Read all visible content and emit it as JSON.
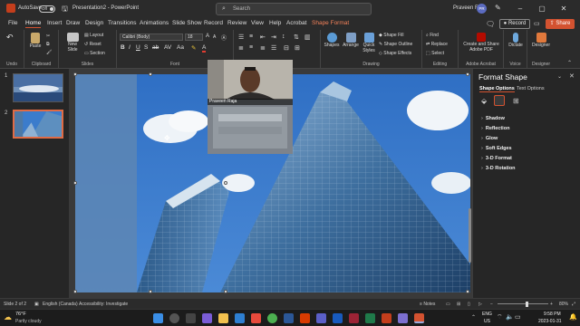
{
  "titlebar": {
    "autosave_label": "AutoSave",
    "autosave_state": "Off",
    "doc_title": "Presentation2 - PowerPoint",
    "search_placeholder": "Search",
    "user_name": "Praveen R",
    "user_initials": "PR"
  },
  "tabs": [
    "File",
    "Home",
    "Insert",
    "Draw",
    "Design",
    "Transitions",
    "Animations",
    "Slide Show",
    "Record",
    "Review",
    "View",
    "Help",
    "Acrobat",
    "Shape Format"
  ],
  "active_tab": "Home",
  "record_label": "Record",
  "share_label": "Share",
  "ribbon": {
    "undo_label": "Undo",
    "clipboard": {
      "paste": "Paste",
      "group": "Clipboard"
    },
    "slides": {
      "new_slide": "New Slide",
      "layout": "Layout",
      "reset": "Reset",
      "section": "Section",
      "group": "Slides"
    },
    "font": {
      "name": "Calibri (Body)",
      "size": "18",
      "group": "Font"
    },
    "paragraph_group": "Paragraph",
    "drawing": {
      "shapes": "Shapes",
      "arrange": "Arrange",
      "quick_styles": "Quick Styles",
      "shape_fill": "Shape Fill",
      "shape_outline": "Shape Outline",
      "shape_effects": "Shape Effects",
      "group": "Drawing"
    },
    "editing": {
      "find": "Find",
      "replace": "Replace",
      "select": "Select",
      "group": "Editing"
    },
    "acrobat": {
      "create_share": "Create and Share Adobe PDF",
      "group": "Adobe Acrobat"
    },
    "voice": {
      "dictate": "Dictate",
      "group": "Voice"
    },
    "designer": {
      "label": "Designer",
      "group": "Designer"
    }
  },
  "slides": [
    {
      "number": "1"
    },
    {
      "number": "2"
    }
  ],
  "selected_slide": "2",
  "webcam": {
    "name": "Praveen Raja"
  },
  "format_pane": {
    "title": "Format Shape",
    "tabs": [
      "Shape Options",
      "Text Options"
    ],
    "active_tab": "Shape Options",
    "sections": [
      "Shadow",
      "Reflection",
      "Glow",
      "Soft Edges",
      "3-D Format",
      "3-D Rotation"
    ]
  },
  "status": {
    "slide_info": "Slide 2 of 2",
    "language": "English (Canada)",
    "accessibility": "Accessibility: Investigate",
    "notes": "Notes",
    "zoom": "80%"
  },
  "taskbar": {
    "temperature": "76°F",
    "weather": "Partly cloudy",
    "lang_top": "ENG",
    "lang_bottom": "US",
    "time": "9:58 PM",
    "date": "2023-01-31"
  },
  "colors": {
    "accent": "#d35230",
    "shape_format": "#f4825a"
  }
}
